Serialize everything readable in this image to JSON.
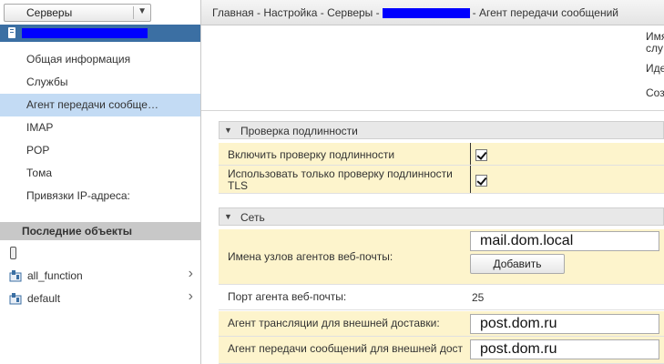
{
  "left": {
    "dropdown_label": "Серверы",
    "nav_items": [
      {
        "label": "Общая информация",
        "active": false
      },
      {
        "label": "Службы",
        "active": false
      },
      {
        "label": "Агент передачи сообще…",
        "active": true
      },
      {
        "label": "IMAP",
        "active": false
      },
      {
        "label": "POP",
        "active": false
      },
      {
        "label": "Тома",
        "active": false
      },
      {
        "label": "Привязки IP-адреса:",
        "active": false
      }
    ],
    "recent_header": "Последние объекты",
    "recent_items": [
      {
        "label": "",
        "icon": "phone-icon"
      },
      {
        "label": "all_function",
        "icon": "pool-icon"
      },
      {
        "label": "default",
        "icon": "pool-icon"
      }
    ]
  },
  "breadcrumb": {
    "part1": "Главная - Настройка - Серверы -",
    "part2": "- Агент передачи сообщений"
  },
  "top_info": {
    "line1": "Имя",
    "line2": "слу",
    "line3": "Иде",
    "line4": "Соз"
  },
  "auth_section": {
    "title": "Проверка подлинности",
    "enable_auth_label": "Включить проверку подлинности",
    "tls_only_label_1": "Использовать только проверку подлинности",
    "tls_only_label_2": "TLS"
  },
  "network_section": {
    "title": "Сеть",
    "webmail_hosts_label": "Имена узлов агентов веб-почты:",
    "webmail_host_value": "mail.dom.local",
    "add_button": "Добавить",
    "webmail_port_label": "Порт агента веб-почты:",
    "webmail_port_value": "25",
    "relay_label": "Агент трансляции для внешней доставки:",
    "relay_value": "post.dom.ru",
    "mta_label": "Агент передачи сообщений для внешней дост",
    "mta_value": "post.dom.ru"
  },
  "colors": {
    "server_bar": "#3b6fa3",
    "active_nav": "#c3dbf4",
    "yellow_row": "#fdf4cc",
    "redaction": "#0000ff"
  }
}
